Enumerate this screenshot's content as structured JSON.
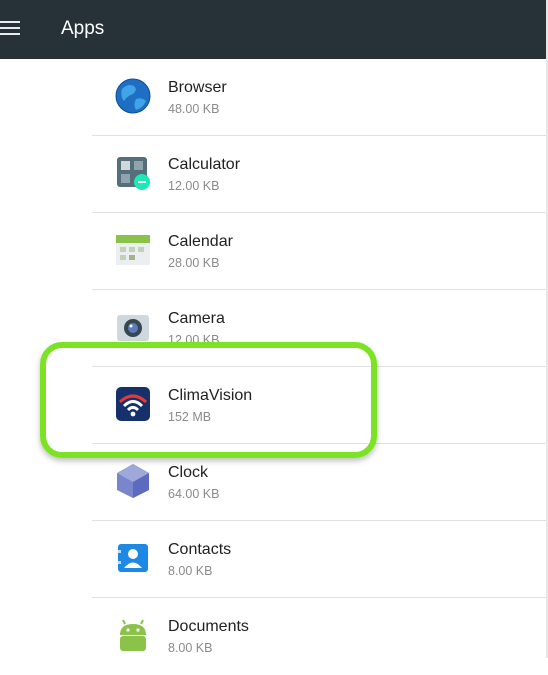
{
  "toolbar": {
    "title": "Apps",
    "menu_icon": "menu-icon"
  },
  "apps": [
    {
      "name": "Browser",
      "size": "48.00 KB",
      "icon": "browser-globe-icon"
    },
    {
      "name": "Calculator",
      "size": "12.00 KB",
      "icon": "calculator-icon"
    },
    {
      "name": "Calendar",
      "size": "28.00 KB",
      "icon": "calendar-icon"
    },
    {
      "name": "Camera",
      "size": "12.00 KB",
      "icon": "camera-icon"
    },
    {
      "name": "ClimaVision",
      "size": "152 MB",
      "icon": "climavision-wifi-icon"
    },
    {
      "name": "Clock",
      "size": "64.00 KB",
      "icon": "clock-icon"
    },
    {
      "name": "Contacts",
      "size": "8.00 KB",
      "icon": "contacts-icon"
    },
    {
      "name": "Documents",
      "size": "8.00 KB",
      "icon": "android-documents-icon"
    }
  ],
  "highlight_color": "#7be323",
  "toolbar_color": "#263238"
}
